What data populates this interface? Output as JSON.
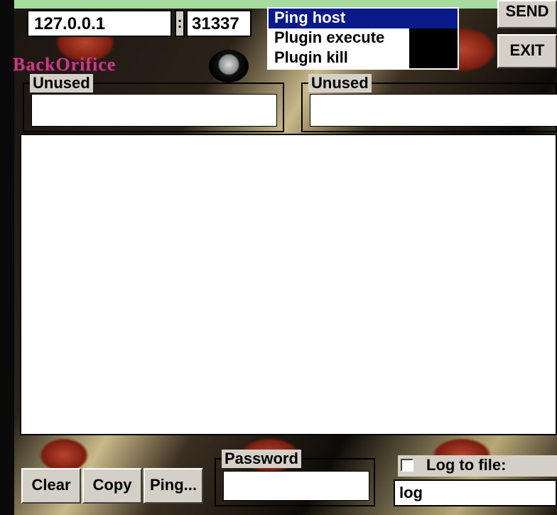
{
  "connection": {
    "host": "127.0.0.1",
    "separator": ":",
    "port": "31337"
  },
  "command_list": {
    "items": [
      "Ping host",
      "Plugin execute",
      "Plugin kill"
    ],
    "selected": "Ping host"
  },
  "buttons": {
    "send": "SEND",
    "exit": "EXIT",
    "clear": "Clear",
    "copy": "Copy",
    "ping": "Ping..."
  },
  "logo": {
    "text": "BackOrifice"
  },
  "params": {
    "param1_label": "Unused",
    "param2_label": "Unused",
    "param1_value": "",
    "param2_value": ""
  },
  "output": {
    "text": ""
  },
  "password": {
    "label": "Password",
    "value": ""
  },
  "log": {
    "checkbox_label": "Log to file:",
    "checked": false,
    "filename": "log"
  },
  "colors": {
    "selection": "#0a1a8a",
    "button_face": "#d4d0c8",
    "logo": "#c93a8a"
  }
}
